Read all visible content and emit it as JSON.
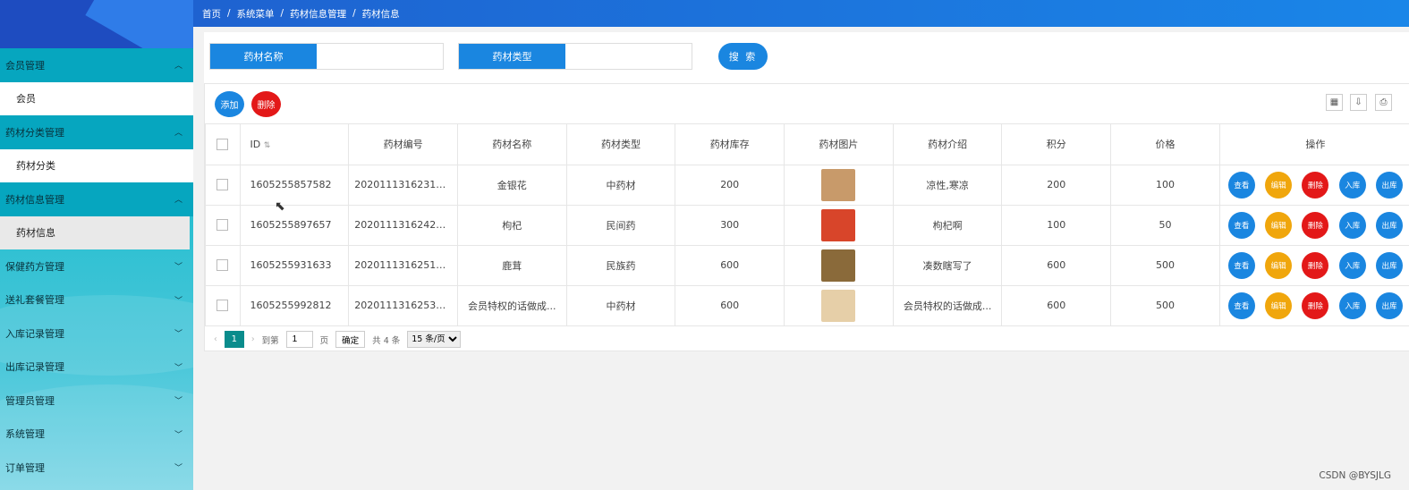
{
  "breadcrumb": [
    "首页",
    "系统菜单",
    "药材信息管理",
    "药材信息"
  ],
  "sidebar": {
    "items": [
      {
        "label": "会员管理",
        "type": "group",
        "open": true
      },
      {
        "label": "会员",
        "type": "sub"
      },
      {
        "label": "药材分类管理",
        "type": "group",
        "open": true
      },
      {
        "label": "药材分类",
        "type": "sub"
      },
      {
        "label": "药材信息管理",
        "type": "group",
        "open": true
      },
      {
        "label": "药材信息",
        "type": "sub",
        "active": true
      },
      {
        "label": "保健药方管理",
        "type": "group"
      },
      {
        "label": "送礼套餐管理",
        "type": "group"
      },
      {
        "label": "入库记录管理",
        "type": "group"
      },
      {
        "label": "出库记录管理",
        "type": "group"
      },
      {
        "label": "管理员管理",
        "type": "group"
      },
      {
        "label": "系统管理",
        "type": "group"
      },
      {
        "label": "订单管理",
        "type": "group"
      }
    ]
  },
  "search": {
    "name_label": "药材名称",
    "type_label": "药材类型",
    "button": "搜 索"
  },
  "toolbar": {
    "add": "添加",
    "delete": "删除",
    "icons": [
      "grid-icon",
      "export-icon",
      "print-icon"
    ]
  },
  "table": {
    "headers": [
      "ID",
      "药材编号",
      "药材名称",
      "药材类型",
      "药材库存",
      "药材图片",
      "药材介绍",
      "积分",
      "价格",
      "操作"
    ],
    "rows": [
      {
        "id": "1605255857582",
        "code": "20201113162313 40",
        "name": "金银花",
        "type": "中药材",
        "stock": "200",
        "img": "#c89a6a",
        "intro": "凉性,寒凉",
        "points": "200",
        "price": "100"
      },
      {
        "id": "1605255897657",
        "code": "202011131624217...",
        "name": "枸杞",
        "type": "民间药",
        "stock": "300",
        "img": "#d8452a",
        "intro": "枸杞啊",
        "points": "100",
        "price": "50"
      },
      {
        "id": "1605255931633",
        "code": "2020111316251902",
        "name": "鹿茸",
        "type": "民族药",
        "stock": "600",
        "img": "#8a6a3a",
        "intro": "凑数瞎写了",
        "points": "600",
        "price": "500"
      },
      {
        "id": "1605255992812",
        "code": "202011131625371...",
        "name": "会员特权的话做成...",
        "type": "中药材",
        "stock": "600",
        "img": "#e6cfa8",
        "intro": "会员特权的话做成...",
        "points": "600",
        "price": "500"
      }
    ],
    "ops": [
      "查看",
      "编辑",
      "删除",
      "入库",
      "出库"
    ]
  },
  "pager": {
    "current": "1",
    "goto_label": "到第",
    "page_value": "1",
    "page_unit": "页",
    "confirm": "确定",
    "total": "共 4 条",
    "size": "15 条/页"
  },
  "watermark": "CSDN @BYSJLG"
}
